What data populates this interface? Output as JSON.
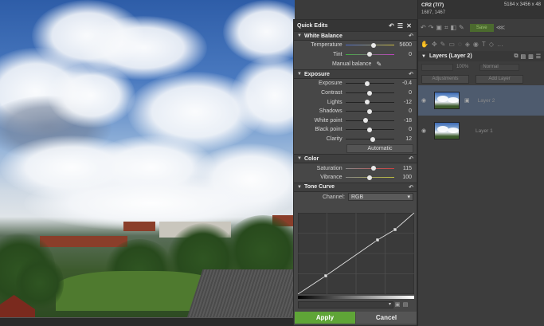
{
  "quick_edits": {
    "title": "Quick Edits",
    "sections": {
      "white_balance": "White Balance",
      "exposure": "Exposure",
      "color": "Color",
      "tone_curve": "Tone Curve"
    },
    "white_balance": [
      {
        "label": "Temperature",
        "value": "5600",
        "fraction": 0.58
      },
      {
        "label": "Tint",
        "value": "0",
        "fraction": 0.5
      }
    ],
    "manual_balance": "Manual balance",
    "exposure": [
      {
        "label": "Exposure",
        "value": "-0.4",
        "fraction": 0.45
      },
      {
        "label": "Contrast",
        "value": "0",
        "fraction": 0.5
      },
      {
        "label": "Lights",
        "value": "-12",
        "fraction": 0.44
      },
      {
        "label": "Shadows",
        "value": "0",
        "fraction": 0.5
      },
      {
        "label": "White point",
        "value": "-18",
        "fraction": 0.41
      },
      {
        "label": "Black point",
        "value": "0",
        "fraction": 0.5
      },
      {
        "label": "Clarity",
        "value": "12",
        "fraction": 0.56
      }
    ],
    "automatic": "Automatic",
    "color": [
      {
        "label": "Saturation",
        "value": "115",
        "fraction": 0.57
      },
      {
        "label": "Vibrance",
        "value": "100",
        "fraction": 0.5
      }
    ],
    "channel_label": "Channel:",
    "channel_value": "RGB",
    "apply": "Apply",
    "cancel": "Cancel"
  },
  "file_info": {
    "name": "CR2 (7/7)",
    "dimensions": "5184 x 3456 x 48",
    "coords": "1687, 1467"
  },
  "toolbar": {
    "save_label": "Save"
  },
  "layers": {
    "title": "Layers (Layer 2)",
    "opacity": "100%",
    "blend": "Normal",
    "tab_adjustments": "Adjustments",
    "tab_add_layer": "Add Layer",
    "items": [
      {
        "name": "Layer 2"
      },
      {
        "name": "Layer 1"
      }
    ]
  }
}
